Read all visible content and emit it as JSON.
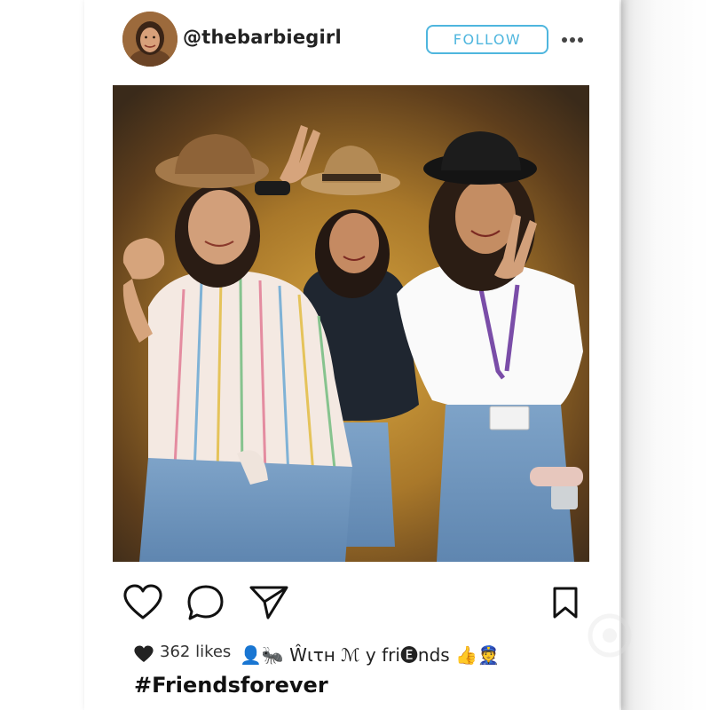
{
  "post": {
    "username": "@thebarbiegirl",
    "follow_label": "FOLLOW",
    "likes_label": "362 likes",
    "caption": "👤🐜 Ŵιτн ℳ y fri🅔nds 👍👮",
    "hashtag": "#Friendsforever"
  },
  "icons": {
    "more": "more-dots-icon",
    "like": "heart-icon",
    "comment": "comment-bubble-icon",
    "share": "send-paper-plane-icon",
    "save": "bookmark-icon",
    "likes": "filled-heart-icon"
  },
  "colors": {
    "accent": "#4fb6de",
    "text": "#222222",
    "background": "#ffffff"
  }
}
